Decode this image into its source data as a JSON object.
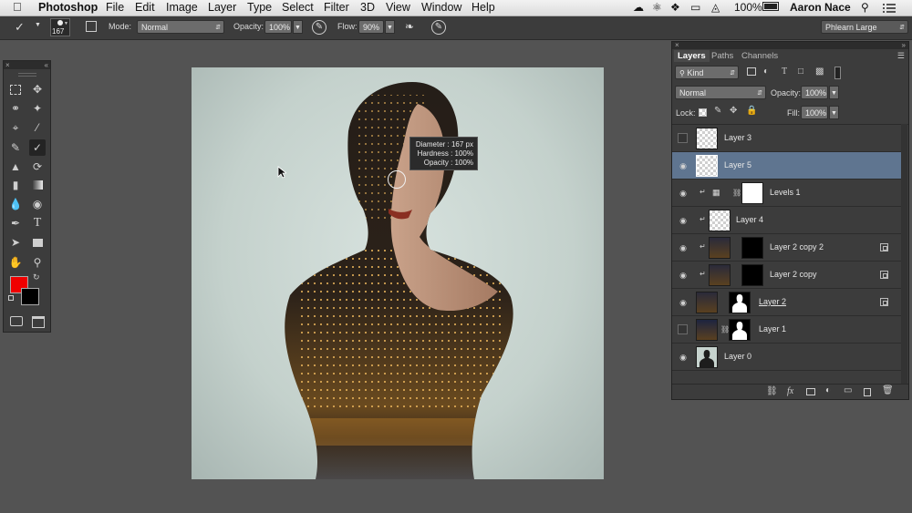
{
  "menubar": {
    "app_name": "Photoshop",
    "menus": [
      "File",
      "Edit",
      "Image",
      "Layer",
      "Type",
      "Select",
      "Filter",
      "3D",
      "View",
      "Window",
      "Help"
    ],
    "battery": "100%",
    "user": "Aaron Nace"
  },
  "options_bar": {
    "brush_size": "167",
    "mode_label": "Mode:",
    "mode_value": "Normal",
    "opacity_label": "Opacity:",
    "opacity_value": "100%",
    "flow_label": "Flow:",
    "flow_value": "90%",
    "workspace": "Phlearn Large"
  },
  "brush_tooltip": {
    "diameter": "Diameter : 167 px",
    "hardness": "Hardness :  100%",
    "opacity": "Opacity :  100%"
  },
  "layers_panel": {
    "tabs": [
      "Layers",
      "Paths",
      "Channels"
    ],
    "kind_filter": "Kind",
    "blend_mode": "Normal",
    "opacity_label": "Opacity:",
    "opacity_value": "100%",
    "lock_label": "Lock:",
    "fill_label": "Fill:",
    "fill_value": "100%",
    "layers": [
      {
        "name": "Layer 3",
        "visible": false,
        "selected": false
      },
      {
        "name": "Layer 5",
        "visible": true,
        "selected": true
      },
      {
        "name": "Levels 1",
        "visible": true,
        "selected": false
      },
      {
        "name": "Layer 4",
        "visible": true,
        "selected": false
      },
      {
        "name": "Layer 2 copy 2",
        "visible": true,
        "selected": false
      },
      {
        "name": "Layer 2 copy",
        "visible": true,
        "selected": false
      },
      {
        "name": "Layer 2",
        "visible": true,
        "selected": false
      },
      {
        "name": "Layer 1",
        "visible": false,
        "selected": false
      },
      {
        "name": "Layer 0",
        "visible": true,
        "selected": false
      }
    ]
  },
  "colors": {
    "foreground": "#f00000",
    "background": "#000000",
    "selected_layer": "#5f7590"
  }
}
